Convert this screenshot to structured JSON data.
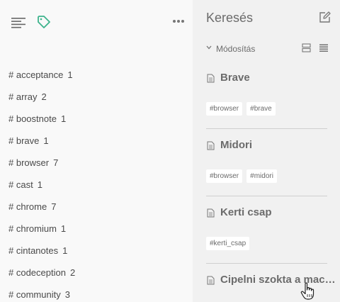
{
  "left": {
    "tags": [
      {
        "label": "# acceptance",
        "count": "1"
      },
      {
        "label": "# array",
        "count": "2"
      },
      {
        "label": "# boostnote",
        "count": "1"
      },
      {
        "label": "# brave",
        "count": "1"
      },
      {
        "label": "# browser",
        "count": "7"
      },
      {
        "label": "# cast",
        "count": "1"
      },
      {
        "label": "# chrome",
        "count": "7"
      },
      {
        "label": "# chromium",
        "count": "1"
      },
      {
        "label": "# cintanotes",
        "count": "1"
      },
      {
        "label": "# codeception",
        "count": "2"
      },
      {
        "label": "# community",
        "count": "3"
      }
    ]
  },
  "right": {
    "search_title": "Keresés",
    "sort_label": "Módosítás",
    "notes": [
      {
        "title": "Brave",
        "tags": [
          "#browser",
          "#brave"
        ]
      },
      {
        "title": "Midori",
        "tags": [
          "#browser",
          "#midori"
        ]
      },
      {
        "title": "Kerti csap",
        "tags": [
          "#kerti_csap"
        ]
      },
      {
        "title": "Cipelni szokta a macsk...",
        "tags": []
      }
    ]
  },
  "colors": {
    "accent": "#3db38c",
    "left_bg": "#f9f9f9",
    "right_bg": "#f1f1f1"
  }
}
